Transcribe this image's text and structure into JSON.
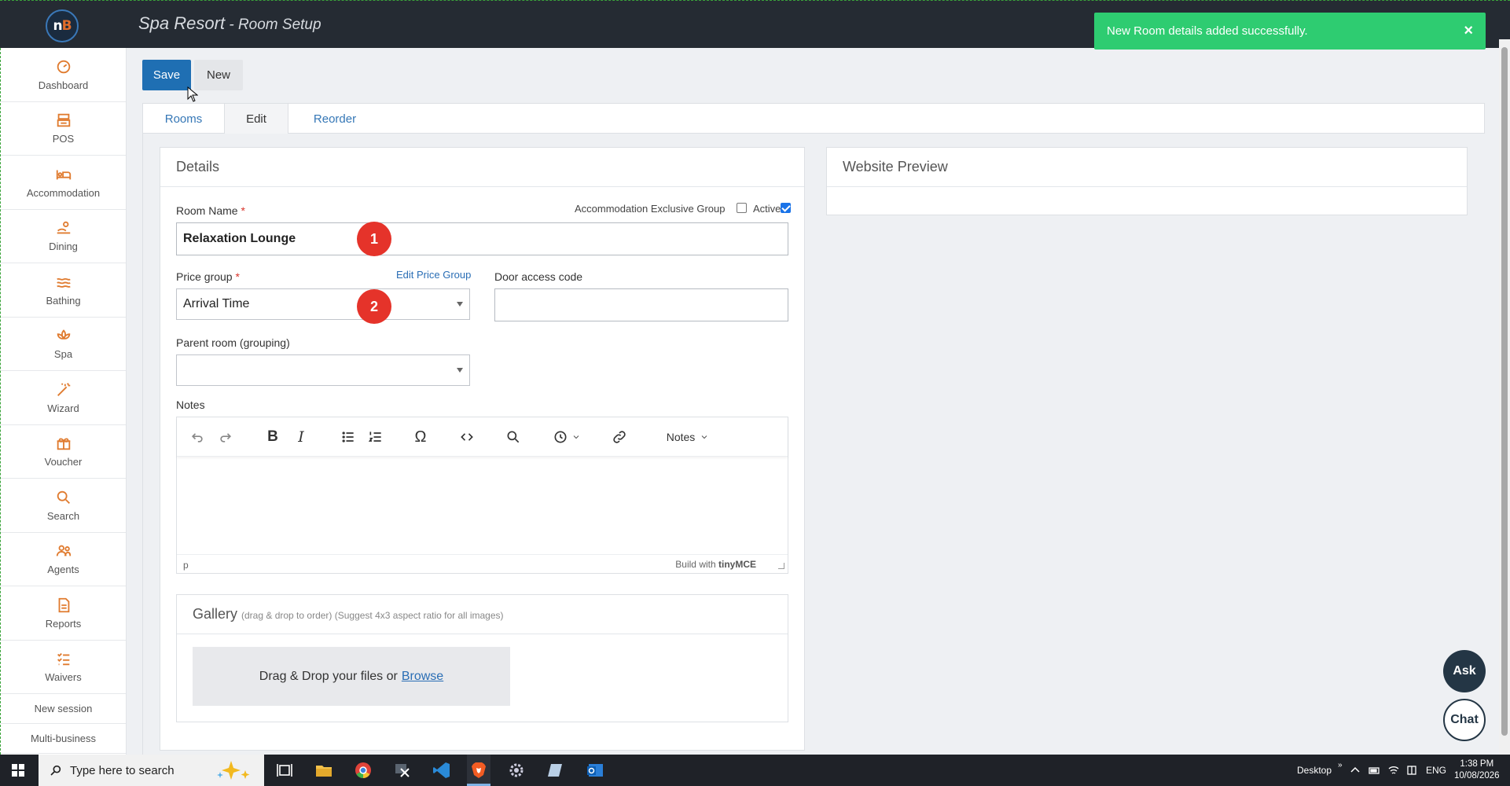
{
  "header": {
    "logo_text_n": "n",
    "logo_text_b": "B",
    "title": "Spa Resort",
    "separator": " - ",
    "subtitle": "Room Setup"
  },
  "toast": {
    "message": "New Room details added successfully.",
    "close": "×"
  },
  "sidebar": {
    "items": [
      {
        "label": "Dashboard",
        "icon": "dashboard-icon"
      },
      {
        "label": "POS",
        "icon": "pos-icon"
      },
      {
        "label": "Accommodation",
        "icon": "bed-icon"
      },
      {
        "label": "Dining",
        "icon": "dining-icon"
      },
      {
        "label": "Bathing",
        "icon": "waves-icon"
      },
      {
        "label": "Spa",
        "icon": "lotus-icon"
      },
      {
        "label": "Wizard",
        "icon": "wand-icon"
      },
      {
        "label": "Voucher",
        "icon": "gift-icon"
      },
      {
        "label": "Search",
        "icon": "search-icon"
      },
      {
        "label": "Agents",
        "icon": "agents-icon"
      },
      {
        "label": "Reports",
        "icon": "report-icon"
      },
      {
        "label": "Waivers",
        "icon": "list-icon"
      }
    ],
    "links": [
      "New session",
      "Multi-business"
    ],
    "accent": "#e07b2f"
  },
  "toolbar": {
    "save": "Save",
    "new": "New"
  },
  "tabs": [
    "Rooms",
    "Edit",
    "Reorder"
  ],
  "details": {
    "title": "Details",
    "room_name_label": "Room Name",
    "required": "*",
    "exclusive_group_label": "Accommodation Exclusive Group",
    "active_label": "Active",
    "room_name_value": "Relaxation Lounge",
    "price_group_label": "Price group",
    "edit_price_group": "Edit Price Group",
    "price_group_value": "Arrival Time",
    "door_access_label": "Door access code",
    "door_access_value": "",
    "parent_room_label": "Parent room (grouping)",
    "parent_room_value": "",
    "notes_label": "Notes",
    "badge_1": "1",
    "badge_2": "2"
  },
  "editor": {
    "format_menu": "Notes",
    "status_path": "p",
    "branding_prefix": "Build with",
    "branding": "tinyMCE"
  },
  "gallery": {
    "title": "Gallery",
    "hint": "(drag & drop to order) (Suggest 4x3 aspect ratio for all images)",
    "drop_text": "Drag & Drop your files or",
    "browse": "Browse"
  },
  "preview": {
    "title": "Website Preview"
  },
  "fabs": {
    "ask": "Ask",
    "chat": "Chat"
  },
  "taskbar": {
    "search_placeholder": "Type here to search",
    "desktop": "Desktop",
    "lang": "ENG",
    "time": "1:38 PM",
    "date": "10/08/2026"
  }
}
